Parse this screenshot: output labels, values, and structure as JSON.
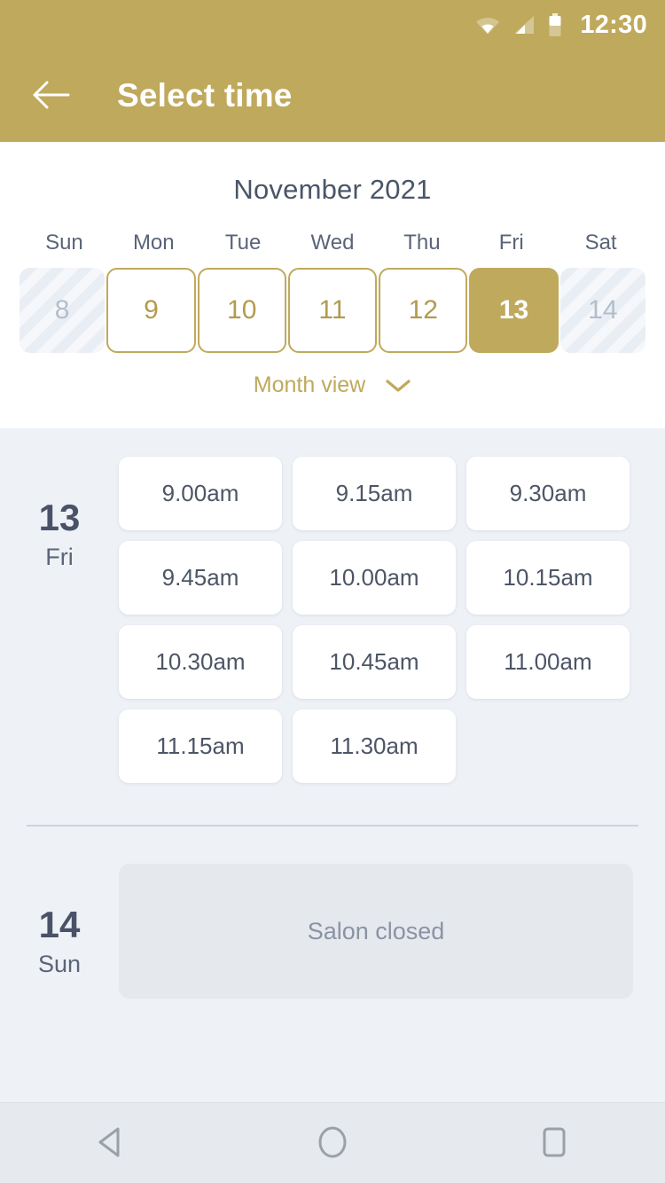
{
  "status_bar": {
    "time": "12:30",
    "icons": [
      "wifi-icon",
      "signal-icon",
      "battery-icon"
    ]
  },
  "app_bar": {
    "back_icon": "arrow-left-icon",
    "title": "Select time"
  },
  "calendar": {
    "month_title": "November 2021",
    "weekdays": [
      "Sun",
      "Mon",
      "Tue",
      "Wed",
      "Thu",
      "Fri",
      "Sat"
    ],
    "days": [
      {
        "num": "8",
        "state": "disabled"
      },
      {
        "num": "9",
        "state": "available"
      },
      {
        "num": "10",
        "state": "available"
      },
      {
        "num": "11",
        "state": "available"
      },
      {
        "num": "12",
        "state": "available"
      },
      {
        "num": "13",
        "state": "selected"
      },
      {
        "num": "14",
        "state": "disabled"
      }
    ],
    "month_view_label": "Month view",
    "month_view_icon": "chevron-down-icon"
  },
  "schedule": [
    {
      "day_number": "13",
      "day_name": "Fri",
      "slots": [
        "9.00am",
        "9.15am",
        "9.30am",
        "9.45am",
        "10.00am",
        "10.15am",
        "10.30am",
        "10.45am",
        "11.00am",
        "11.15am",
        "11.30am"
      ]
    },
    {
      "day_number": "14",
      "day_name": "Sun",
      "closed_message": "Salon closed"
    }
  ],
  "nav_bar": {
    "back_label": "back-triangle-icon",
    "home_label": "home-circle-icon",
    "recents_label": "recents-square-icon"
  },
  "colors": {
    "accent_gold": "#bfa95c",
    "text_dark": "#4a5568",
    "bg_light": "#eef1f6",
    "card_white": "#ffffff",
    "disabled_grey": "#e5e8ed"
  }
}
